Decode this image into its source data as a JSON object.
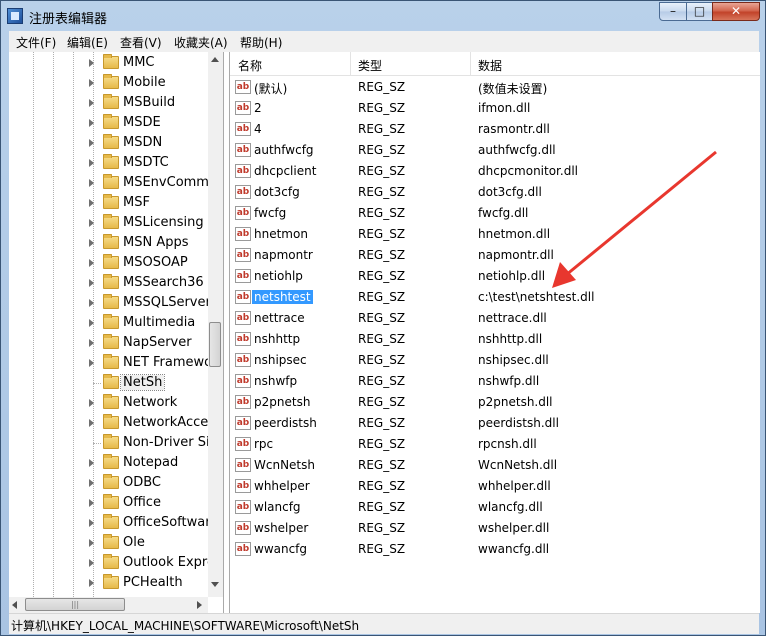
{
  "window": {
    "title": "注册表编辑器",
    "minimize": "–",
    "maximize": "□",
    "close": "✕"
  },
  "menu": [
    "文件(F)",
    "编辑(E)",
    "查看(V)",
    "收藏夹(A)",
    "帮助(H)"
  ],
  "tree": {
    "items": [
      {
        "label": "MMC",
        "expandable": true
      },
      {
        "label": "Mobile",
        "expandable": true
      },
      {
        "label": "MSBuild",
        "expandable": true
      },
      {
        "label": "MSDE",
        "expandable": true
      },
      {
        "label": "MSDN",
        "expandable": true
      },
      {
        "label": "MSDTC",
        "expandable": true
      },
      {
        "label": "MSEnvCommu",
        "expandable": true
      },
      {
        "label": "MSF",
        "expandable": true
      },
      {
        "label": "MSLicensing",
        "expandable": true
      },
      {
        "label": "MSN Apps",
        "expandable": true
      },
      {
        "label": "MSOSOAP",
        "expandable": true
      },
      {
        "label": "MSSearch36",
        "expandable": true
      },
      {
        "label": "MSSQLServer",
        "expandable": true
      },
      {
        "label": "Multimedia",
        "expandable": true
      },
      {
        "label": "NapServer",
        "expandable": true
      },
      {
        "label": "NET Framewo",
        "expandable": true
      },
      {
        "label": "NetSh",
        "expandable": false,
        "selected": true
      },
      {
        "label": "Network",
        "expandable": true
      },
      {
        "label": "NetworkAcces",
        "expandable": true
      },
      {
        "label": "Non-Driver Sig",
        "expandable": false
      },
      {
        "label": "Notepad",
        "expandable": true
      },
      {
        "label": "ODBC",
        "expandable": true
      },
      {
        "label": "Office",
        "expandable": true
      },
      {
        "label": "OfficeSoftware",
        "expandable": true
      },
      {
        "label": "Ole",
        "expandable": true
      },
      {
        "label": "Outlook Expre",
        "expandable": true
      },
      {
        "label": "PCHealth",
        "expandable": true
      }
    ]
  },
  "list": {
    "columns": [
      "名称",
      "类型",
      "数据"
    ],
    "rows": [
      {
        "name": "(默认)",
        "type": "REG_SZ",
        "data": "(数值未设置)"
      },
      {
        "name": "2",
        "type": "REG_SZ",
        "data": "ifmon.dll"
      },
      {
        "name": "4",
        "type": "REG_SZ",
        "data": "rasmontr.dll"
      },
      {
        "name": "authfwcfg",
        "type": "REG_SZ",
        "data": "authfwcfg.dll"
      },
      {
        "name": "dhcpclient",
        "type": "REG_SZ",
        "data": "dhcpcmonitor.dll"
      },
      {
        "name": "dot3cfg",
        "type": "REG_SZ",
        "data": "dot3cfg.dll"
      },
      {
        "name": "fwcfg",
        "type": "REG_SZ",
        "data": "fwcfg.dll"
      },
      {
        "name": "hnetmon",
        "type": "REG_SZ",
        "data": "hnetmon.dll"
      },
      {
        "name": "napmontr",
        "type": "REG_SZ",
        "data": "napmontr.dll"
      },
      {
        "name": "netiohlp",
        "type": "REG_SZ",
        "data": "netiohlp.dll"
      },
      {
        "name": "netshtest",
        "type": "REG_SZ",
        "data": "c:\\test\\netshtest.dll",
        "selected": true
      },
      {
        "name": "nettrace",
        "type": "REG_SZ",
        "data": "nettrace.dll"
      },
      {
        "name": "nshhttp",
        "type": "REG_SZ",
        "data": "nshhttp.dll"
      },
      {
        "name": "nshipsec",
        "type": "REG_SZ",
        "data": "nshipsec.dll"
      },
      {
        "name": "nshwfp",
        "type": "REG_SZ",
        "data": "nshwfp.dll"
      },
      {
        "name": "p2pnetsh",
        "type": "REG_SZ",
        "data": "p2pnetsh.dll"
      },
      {
        "name": "peerdistsh",
        "type": "REG_SZ",
        "data": "peerdistsh.dll"
      },
      {
        "name": "rpc",
        "type": "REG_SZ",
        "data": "rpcnsh.dll"
      },
      {
        "name": "WcnNetsh",
        "type": "REG_SZ",
        "data": "WcnNetsh.dll"
      },
      {
        "name": "whhelper",
        "type": "REG_SZ",
        "data": "whhelper.dll"
      },
      {
        "name": "wlancfg",
        "type": "REG_SZ",
        "data": "wlancfg.dll"
      },
      {
        "name": "wshelper",
        "type": "REG_SZ",
        "data": "wshelper.dll"
      },
      {
        "name": "wwancfg",
        "type": "REG_SZ",
        "data": "wwancfg.dll"
      }
    ],
    "value_icon": "ab"
  },
  "status": {
    "path": "计算机\\HKEY_LOCAL_MACHINE\\SOFTWARE\\Microsoft\\NetSh"
  },
  "annotation": {
    "color": "#e8372e"
  },
  "colors": {
    "selection": "#3399ff",
    "folder": "#e6b94a"
  }
}
